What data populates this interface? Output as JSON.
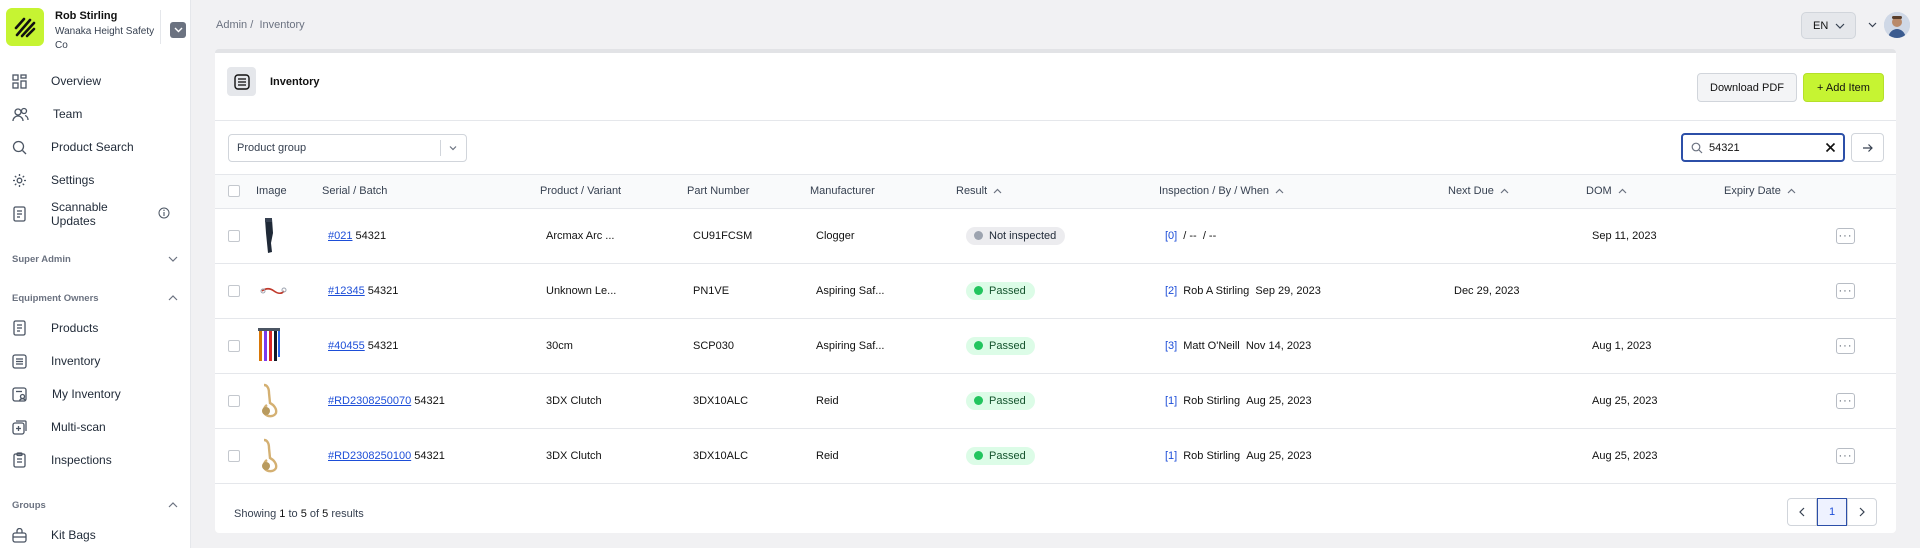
{
  "user": {
    "name": "Rob Stirling",
    "org": "Wanaka Height Safety Co"
  },
  "sidebar": {
    "items": [
      {
        "label": "Overview",
        "icon": "grid-icon"
      },
      {
        "label": "Team",
        "icon": "people-icon"
      },
      {
        "label": "Product Search",
        "icon": "search-icon"
      },
      {
        "label": "Settings",
        "icon": "gear-icon"
      },
      {
        "label": "Scannable Updates",
        "icon": "document-icon"
      }
    ],
    "sections": {
      "super_admin": "Super Admin",
      "equipment_owners": "Equipment Owners",
      "groups": "Groups"
    },
    "equipment_items": [
      {
        "label": "Products",
        "icon": "document-icon"
      },
      {
        "label": "Inventory",
        "icon": "list-icon"
      },
      {
        "label": "My Inventory",
        "icon": "user-list-icon"
      },
      {
        "label": "Multi-scan",
        "icon": "scan-icon"
      },
      {
        "label": "Inspections",
        "icon": "clipboard-icon"
      }
    ],
    "group_items": [
      {
        "label": "Kit Bags",
        "icon": "bag-icon"
      }
    ]
  },
  "header": {
    "breadcrumb": [
      "Admin",
      "Inventory"
    ],
    "breadcrumb_sep": "/",
    "language": "EN"
  },
  "page": {
    "title": "Inventory",
    "download_pdf": "Download PDF",
    "add_item": "+ Add Item"
  },
  "filters": {
    "product_group_placeholder": "Product group",
    "search_value": "54321"
  },
  "table": {
    "columns": [
      "Image",
      "Serial / Batch",
      "Product / Variant",
      "Part Number",
      "Manufacturer",
      "Result",
      "Inspection / By / When",
      "Next Due",
      "DOM",
      "Expiry Date"
    ],
    "rows": [
      {
        "serial": "#021",
        "batch": "54321",
        "product": "Arcmax Arc ...",
        "part": "CU91FCSM",
        "manufacturer": "Clogger",
        "result": "Not inspected",
        "result_status": "none",
        "insp_count": "[0]",
        "insp_by": "/ --",
        "insp_when": "/ --",
        "next_due": "",
        "dom": "Sep 11, 2023",
        "expiry": ""
      },
      {
        "serial": "#12345",
        "batch": "54321",
        "product": "Unknown Le...",
        "part": "PN1VE",
        "manufacturer": "Aspiring Saf...",
        "result": "Passed",
        "result_status": "passed",
        "insp_count": "[2]",
        "insp_by": "Rob A Stirling",
        "insp_when": "Sep 29, 2023",
        "next_due": "Dec 29, 2023",
        "dom": "",
        "expiry": ""
      },
      {
        "serial": "#40455",
        "batch": "54321",
        "product": "30cm",
        "part": "SCP030",
        "manufacturer": "Aspiring Saf...",
        "result": "Passed",
        "result_status": "passed",
        "insp_count": "[3]",
        "insp_by": "Matt O'Neill",
        "insp_when": "Nov 14, 2023",
        "next_due": "",
        "dom": "Aug 1, 2023",
        "expiry": ""
      },
      {
        "serial": "#RD2308250070",
        "batch": "54321",
        "product": "3DX Clutch",
        "part": "3DX10ALC",
        "manufacturer": "Reid",
        "result": "Passed",
        "result_status": "passed",
        "insp_count": "[1]",
        "insp_by": "Rob Stirling",
        "insp_when": "Aug 25, 2023",
        "next_due": "",
        "dom": "Aug 25, 2023",
        "expiry": ""
      },
      {
        "serial": "#RD2308250100",
        "batch": "54321",
        "product": "3DX Clutch",
        "part": "3DX10ALC",
        "manufacturer": "Reid",
        "result": "Passed",
        "result_status": "passed",
        "insp_count": "[1]",
        "insp_by": "Rob Stirling",
        "insp_when": "Aug 25, 2023",
        "next_due": "",
        "dom": "Aug 25, 2023",
        "expiry": ""
      }
    ]
  },
  "footer": {
    "showing_prefix": "Showing",
    "from": "1",
    "to_word": "to",
    "to": "5",
    "of_word": "of",
    "total": "5",
    "results_word": "results",
    "current_page": "1"
  },
  "colors": {
    "accent": "#c6f432",
    "link": "#1d4ed8",
    "passed": "#22c55e",
    "focus": "#2c4fa8"
  }
}
